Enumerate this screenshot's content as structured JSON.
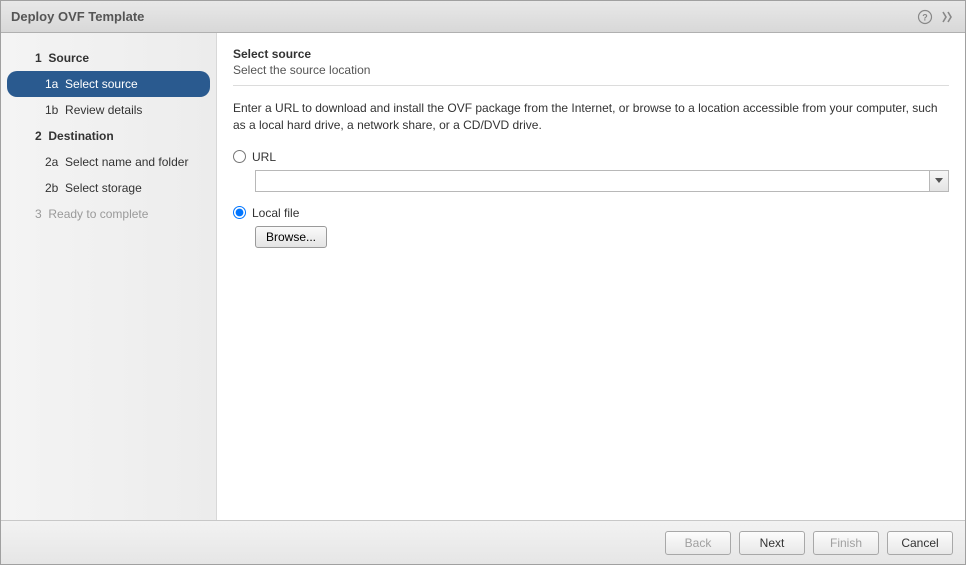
{
  "title": "Deploy OVF Template",
  "sidebar": {
    "step1": {
      "num": "1",
      "label": "Source"
    },
    "step1a": {
      "num": "1a",
      "label": "Select source"
    },
    "step1b": {
      "num": "1b",
      "label": "Review details"
    },
    "step2": {
      "num": "2",
      "label": "Destination"
    },
    "step2a": {
      "num": "2a",
      "label": "Select name and folder"
    },
    "step2b": {
      "num": "2b",
      "label": "Select storage"
    },
    "step3": {
      "num": "3",
      "label": "Ready to complete"
    }
  },
  "main": {
    "heading": "Select source",
    "subheading": "Select the source location",
    "instruction": "Enter a URL to download and install the OVF package from the Internet, or browse to a location accessible from your computer, such as a local hard drive, a network share, or a CD/DVD drive.",
    "url_label": "URL",
    "url_value": "",
    "local_label": "Local file",
    "browse_label": "Browse..."
  },
  "footer": {
    "back": "Back",
    "next": "Next",
    "finish": "Finish",
    "cancel": "Cancel"
  }
}
